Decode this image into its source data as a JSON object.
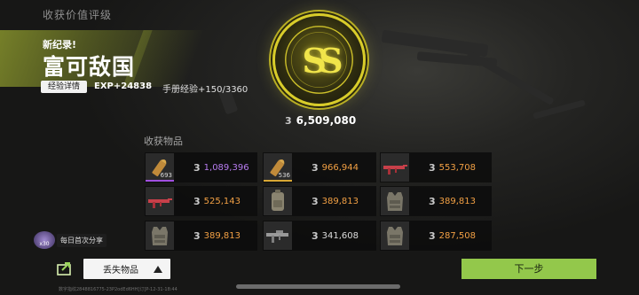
{
  "header": {
    "title": "收获价值评级"
  },
  "record": {
    "label": "新纪录!",
    "map_name": "富可敌国"
  },
  "exp": {
    "detail_label": "经验详情",
    "exp_text": "EXP+24838",
    "manual_text": "手册经验+150/3360"
  },
  "medal": {
    "text": "SS"
  },
  "total": {
    "coin_symbol": "3",
    "value": "6,509,080"
  },
  "items_section": {
    "label": "收获物品"
  },
  "items": [
    {
      "icon": "bullet-icon",
      "qty": "693",
      "value": "1,089,396",
      "color": "purple",
      "rarity": "purple"
    },
    {
      "icon": "bullet-icon",
      "qty": "536",
      "value": "966,944",
      "color": "orange",
      "rarity": "gold"
    },
    {
      "icon": "rifle-red-icon",
      "qty": "",
      "value": "553,708",
      "color": "orange",
      "rarity": ""
    },
    {
      "icon": "rifle-red-icon",
      "qty": "",
      "value": "525,143",
      "color": "orange",
      "rarity": ""
    },
    {
      "icon": "backpack-icon",
      "qty": "",
      "value": "389,813",
      "color": "orange",
      "rarity": ""
    },
    {
      "icon": "armor-vest-icon",
      "qty": "",
      "value": "389,813",
      "color": "orange",
      "rarity": ""
    },
    {
      "icon": "armor-vest-icon",
      "qty": "",
      "value": "389,813",
      "color": "orange",
      "rarity": ""
    },
    {
      "icon": "rifle-gray-icon",
      "qty": "",
      "value": "341,608",
      "color": "gray",
      "rarity": ""
    },
    {
      "icon": "armor-vest-icon",
      "qty": "",
      "value": "287,508",
      "color": "orange",
      "rarity": ""
    }
  ],
  "share": {
    "badge_text": "x30",
    "tip": "每日首次分享"
  },
  "bottom": {
    "lost_items_label": "丢失物品",
    "next_label": "下一步"
  },
  "footer": {
    "id_text": "数字指纹2848816775-23P2odEd6HH[订]P-12-31-18:44"
  },
  "colors": {
    "accent_green": "#93c84b",
    "medal_gold": "#d8cc2a",
    "value_purple": "#b77cf0",
    "value_orange": "#f2a044"
  }
}
